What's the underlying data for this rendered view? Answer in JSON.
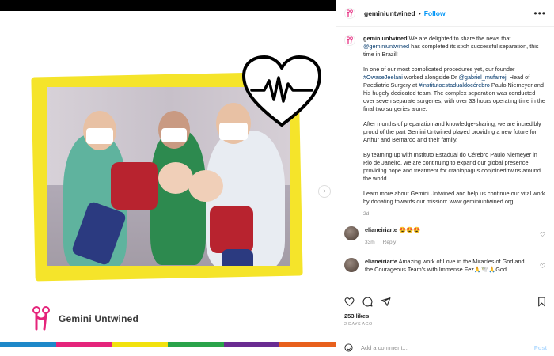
{
  "post": {
    "username": "geminiuntwined",
    "follow_label": "Follow",
    "dot": "•",
    "more": "•••",
    "brand_name": "Gemini Untwined",
    "next_icon": "›",
    "stripe_colors": [
      "#1e88c9",
      "#e5247b",
      "#f2e20d",
      "#2aa34a",
      "#6a2c91",
      "#e8601c"
    ]
  },
  "caption": {
    "username": "geminiuntwined",
    "p1_a": " We are delighted to share the news that ",
    "p1_mention": "@geminiuntwined",
    "p1_b": " has completed its sixth successful separation, this time in Brazil!",
    "p2_a": "In one of our most complicated procedures yet, our founder ",
    "p2_tag": "#OwaseJeelani",
    "p2_b": " worked alongside Dr ",
    "p2_mention": "@gabriel_mufarrej",
    "p2_c": ", Head of Paediatric Surgery at ",
    "p2_tag2": "#institutoestadualdocérebro",
    "p2_d": " Paulo Niemeyer and his hugely dedicated team. The complex separation was conducted over seven separate surgeries, with over 33 hours operating time in the final two surgeries alone.",
    "p3": "After months of preparation and knowledge-sharing, we are incredibly proud of the part Gemini Untwined played providing a new future for Arthur and Bernardo and their family.",
    "p4": "By teaming up with Instituto Estadual do Cérebro Paulo Niemeyer in Rio de Janeiro, we are continuing to expand our global presence, providing hope and treatment for craniopagus conjoined twins around the world.",
    "p5": "Learn more about Gemini Untwined and help us continue our vital work by donating towards our mission: www.geminiuntwined.org",
    "time": "2d"
  },
  "comments": [
    {
      "username": "elianeiriarte",
      "text": " 😍😍😍",
      "time": "33m",
      "reply": "Reply"
    },
    {
      "username": "elianeiriarte",
      "text": " Amazing work of Love in the Miracles of God and the Courageous Team's with Immense Fez🙏🕊️🙏God",
      "time": "",
      "reply": ""
    }
  ],
  "actions": {
    "likes": "253 likes",
    "ago": "2 DAYS AGO"
  },
  "add_comment": {
    "placeholder": "Add a comment...",
    "post_label": "Post"
  }
}
